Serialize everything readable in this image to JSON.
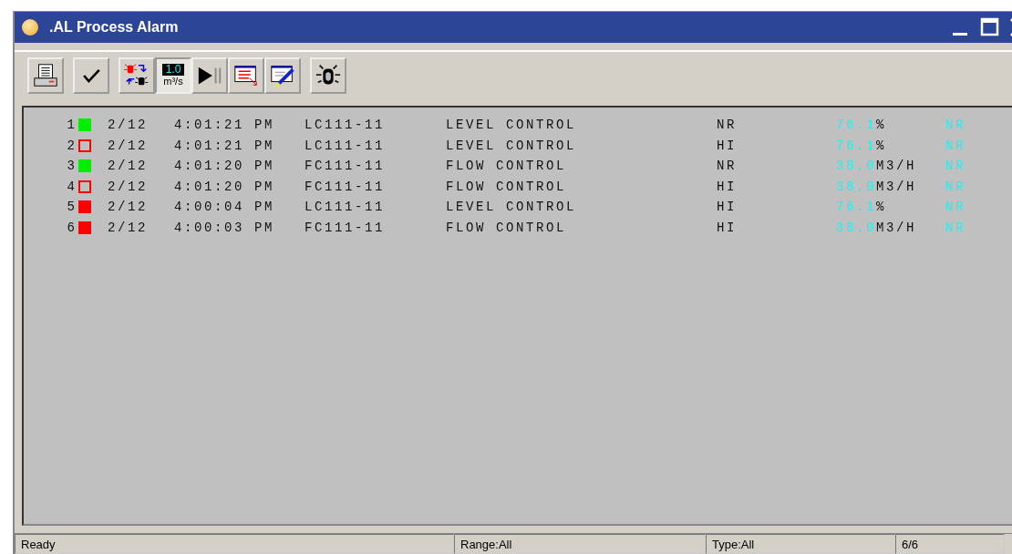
{
  "window": {
    "title": ".AL Process Alarm"
  },
  "toolbar": [
    {
      "kind": "print"
    },
    {
      "kind": "check"
    },
    {
      "kind": "swap"
    },
    {
      "kind": "flow",
      "pressed": true,
      "reading": "1.0",
      "unit": "m³/s"
    },
    {
      "kind": "play"
    },
    {
      "kind": "list"
    },
    {
      "kind": "edit"
    },
    {
      "kind": "light"
    }
  ],
  "alarms": [
    {
      "index": "1",
      "marker": {
        "kind": "filled",
        "color": "#00ee00"
      },
      "date": "2/12",
      "time": "4:01:21 PM",
      "tag": "LC111-11",
      "description": "LEVEL CONTROL",
      "status": "NR",
      "value": "76.1",
      "unit": "%",
      "state": "NR"
    },
    {
      "index": "2",
      "marker": {
        "kind": "hollow",
        "color": "#ff0000"
      },
      "date": "2/12",
      "time": "4:01:21 PM",
      "tag": "LC111-11",
      "description": "LEVEL CONTROL",
      "status": "HI",
      "value": "76.1",
      "unit": "%",
      "state": "NR"
    },
    {
      "index": "3",
      "marker": {
        "kind": "filled",
        "color": "#00ee00"
      },
      "date": "2/12",
      "time": "4:01:20 PM",
      "tag": "FC111-11",
      "description": "FLOW CONTROL",
      "status": "NR",
      "value": "38.0",
      "unit": "M3/H",
      "state": "NR"
    },
    {
      "index": "4",
      "marker": {
        "kind": "hollow",
        "color": "#ff0000"
      },
      "date": "2/12",
      "time": "4:01:20 PM",
      "tag": "FC111-11",
      "description": "FLOW CONTROL",
      "status": "HI",
      "value": "38.0",
      "unit": "M3/H",
      "state": "NR"
    },
    {
      "index": "5",
      "marker": {
        "kind": "filled",
        "color": "#ff0000"
      },
      "date": "2/12",
      "time": "4:00:04 PM",
      "tag": "LC111-11",
      "description": "LEVEL CONTROL",
      "status": "HI",
      "value": "76.1",
      "unit": "%",
      "state": "NR"
    },
    {
      "index": "6",
      "marker": {
        "kind": "filled",
        "color": "#ff0000"
      },
      "date": "2/12",
      "time": "4:00:03 PM",
      "tag": "FC111-11",
      "description": "FLOW CONTROL",
      "status": "HI",
      "value": "38.0",
      "unit": "M3/H",
      "state": "NR"
    }
  ],
  "status_bar": [
    "Ready",
    "Range:All",
    "Type:All",
    "6/6"
  ]
}
